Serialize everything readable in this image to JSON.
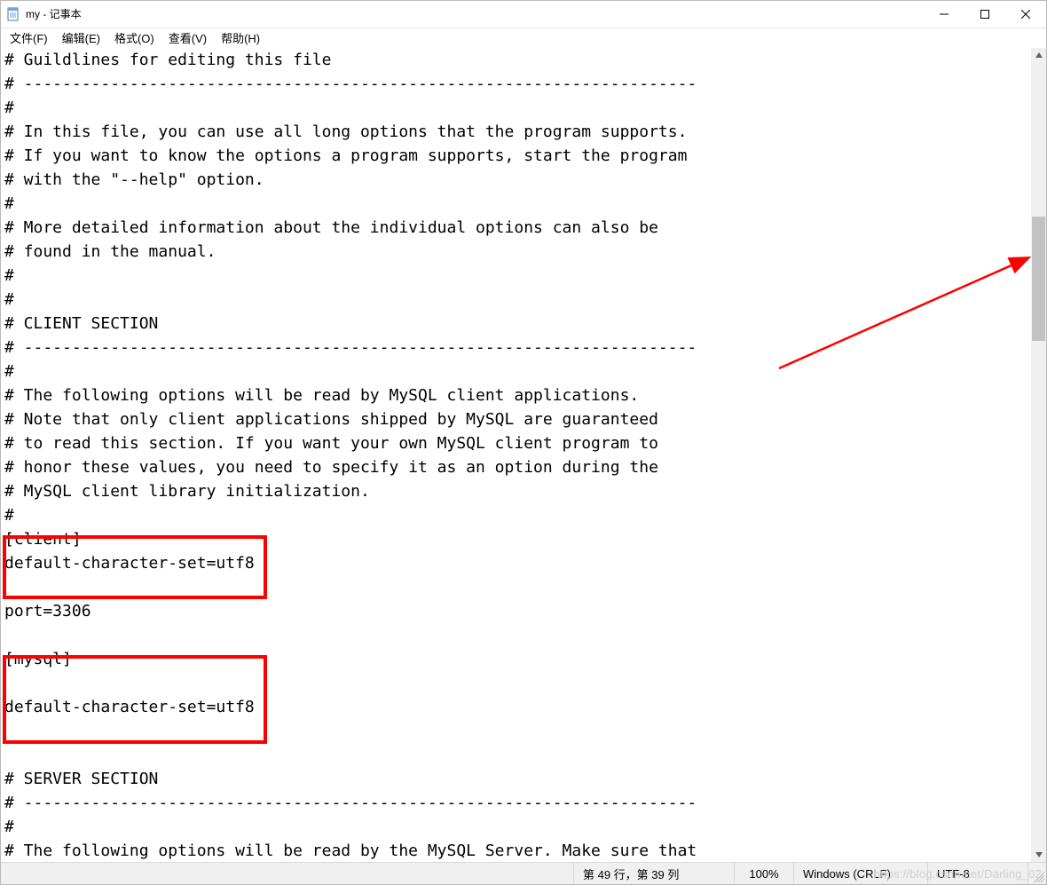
{
  "titlebar": {
    "title": "my - 记事本"
  },
  "menubar": {
    "file": "文件(F)",
    "edit": "编辑(E)",
    "format": "格式(O)",
    "view": "查看(V)",
    "help": "帮助(H)"
  },
  "editor": {
    "lines": [
      "# Guildlines for editing this file",
      "# ----------------------------------------------------------------------",
      "#",
      "# In this file, you can use all long options that the program supports.",
      "# If you want to know the options a program supports, start the program",
      "# with the \"--help\" option.",
      "#",
      "# More detailed information about the individual options can also be",
      "# found in the manual.",
      "#",
      "#",
      "# CLIENT SECTION",
      "# ----------------------------------------------------------------------",
      "#",
      "# The following options will be read by MySQL client applications.",
      "# Note that only client applications shipped by MySQL are guaranteed",
      "# to read this section. If you want your own MySQL client program to",
      "# honor these values, you need to specify it as an option during the",
      "# MySQL client library initialization.",
      "#",
      "[client]",
      "default-character-set=utf8",
      "",
      "port=3306",
      "",
      "[mysql]",
      "",
      "default-character-set=utf8",
      "",
      "",
      "# SERVER SECTION",
      "# ----------------------------------------------------------------------",
      "#",
      "# The following options will be read by the MySQL Server. Make sure that"
    ]
  },
  "statusbar": {
    "position": "第 49 行，第 39 列",
    "zoom": "100%",
    "line_ending": "Windows (CRLF)",
    "encoding": "UTF-8"
  },
  "watermark": "https://blog.csdn.net/Darling_02"
}
